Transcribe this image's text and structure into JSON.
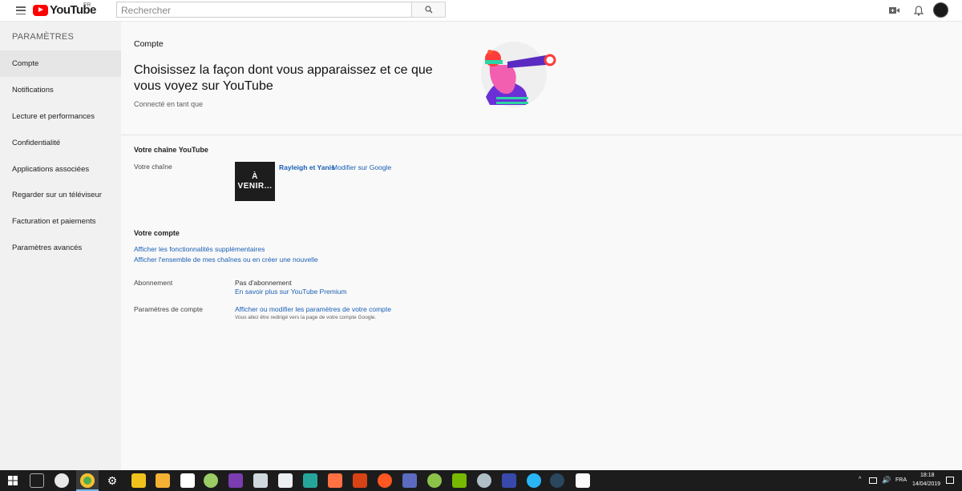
{
  "header": {
    "logo_text": "YouTube",
    "country": "FR",
    "search_placeholder": "Rechercher"
  },
  "sidebar": {
    "title": "PARAMÈTRES",
    "items": [
      {
        "label": "Compte",
        "active": true
      },
      {
        "label": "Notifications"
      },
      {
        "label": "Lecture et performances"
      },
      {
        "label": "Confidentialité"
      },
      {
        "label": "Applications associées"
      },
      {
        "label": "Regarder sur un téléviseur"
      },
      {
        "label": "Facturation et paiements"
      },
      {
        "label": "Paramètres avancés"
      }
    ]
  },
  "main": {
    "section_title": "Compte",
    "headline": "Choisissez la façon dont vous apparaissez et ce que vous voyez sur YouTube",
    "connected_as": "Connecté en tant que",
    "channel_section": {
      "title": "Votre chaîne YouTube",
      "label": "Votre chaîne",
      "channel_name": "Rayleigh et Yanis",
      "edit_link": "Modifier sur Google",
      "thumb_line1": "À",
      "thumb_line2": "VENIR..."
    },
    "account_section": {
      "title": "Votre compte",
      "link1": "Afficher les fonctionnalités supplémentaires",
      "link2": "Afficher l'ensemble de mes chaînes ou en créer une nouvelle",
      "subscription_label": "Abonnement",
      "subscription_value": "Pas d'abonnement",
      "subscription_link": "En savoir plus sur YouTube Premium",
      "settings_label": "Paramètres de compte",
      "settings_link": "Afficher ou modifier les paramètres de votre compte",
      "settings_note": "Vous allez être redirigé vers la page de votre compte Google."
    }
  },
  "taskbar": {
    "language": "FRA",
    "time": "18:18",
    "date": "14/04/2019"
  },
  "colors": {
    "brand_red": "#ff0000",
    "link_blue": "#1a5fb4",
    "sidebar_bg": "#f1f1f1"
  }
}
